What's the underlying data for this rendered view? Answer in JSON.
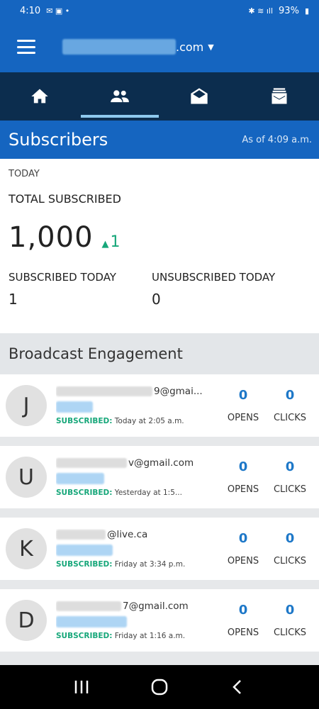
{
  "status_bar": {
    "time": "4:10",
    "battery": "93%"
  },
  "app_bar": {
    "account_suffix": ".com"
  },
  "tabs": [
    {
      "icon": "home-icon"
    },
    {
      "icon": "people-icon",
      "active": true
    },
    {
      "icon": "open-envelope-icon"
    },
    {
      "icon": "inbox-icon"
    }
  ],
  "subscribers": {
    "title": "Subscribers",
    "as_of": "As of 4:09 a.m.",
    "today_label": "TODAY",
    "total_label": "TOTAL SUBSCRIBED",
    "total_value": "1,000",
    "total_delta": "1",
    "subscribed_today_label": "SUBSCRIBED TODAY",
    "subscribed_today_value": "1",
    "unsubscribed_today_label": "UNSUBSCRIBED TODAY",
    "unsubscribed_today_value": "0"
  },
  "engagement": {
    "title": "Broadcast Engagement",
    "opens_label": "OPENS",
    "clicks_label": "CLICKS",
    "subscribed_tag": "SUBSCRIBED:",
    "items": [
      {
        "initial": "J",
        "email_suffix": "9@gmai...",
        "time": "Today at 2:05 a.m.",
        "opens": "0",
        "clicks": "0"
      },
      {
        "initial": "U",
        "email_suffix": "v@gmail.com",
        "time": "Yesterday at 1:5...",
        "opens": "0",
        "clicks": "0"
      },
      {
        "initial": "K",
        "email_suffix": "@live.ca",
        "time": "Friday at 3:34 p.m.",
        "opens": "0",
        "clicks": "0"
      },
      {
        "initial": "D",
        "email_suffix": "7@gmail.com",
        "time": "Friday at 1:16 a.m.",
        "opens": "0",
        "clicks": "0"
      }
    ]
  }
}
